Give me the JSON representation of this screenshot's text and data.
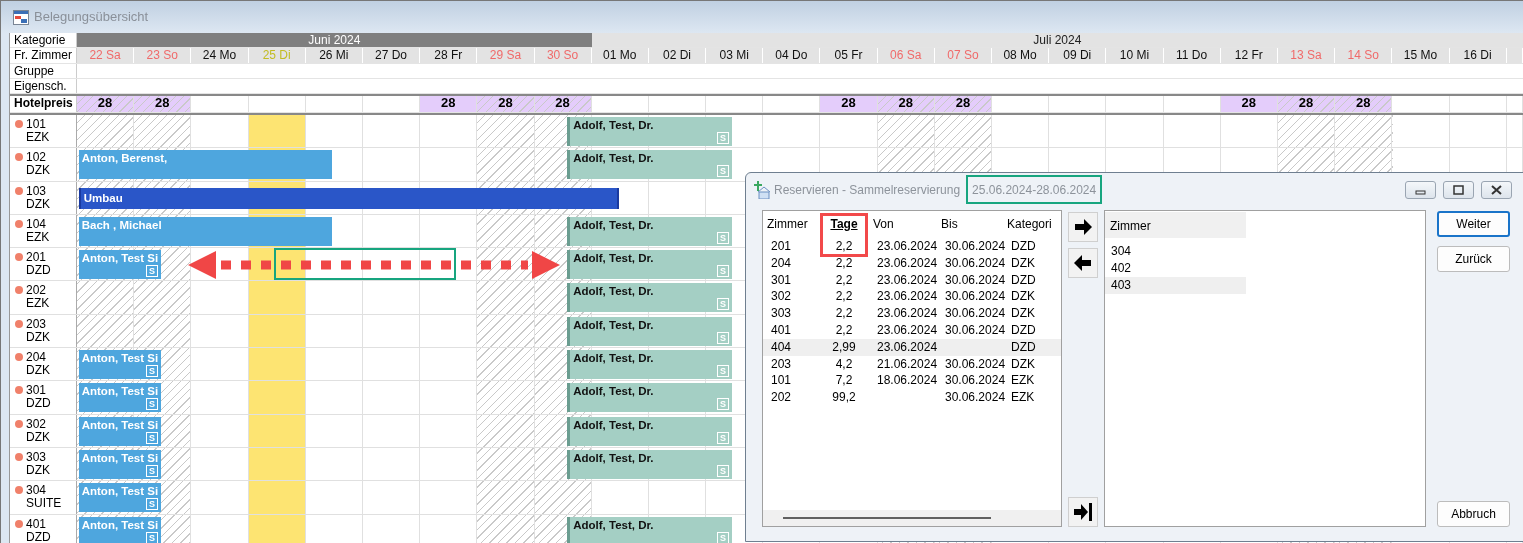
{
  "window": {
    "title": "Belegungsübersicht"
  },
  "header_labels": [
    "Kategorie",
    "Fr. Zimmer",
    "Gruppe",
    "Eigensch."
  ],
  "months": [
    {
      "label": "Juni 2024",
      "highlighted": true
    },
    {
      "label": "Juli 2024",
      "highlighted": false
    }
  ],
  "days": [
    {
      "label": "22 Sa",
      "weekend": true,
      "today": false,
      "price": "28"
    },
    {
      "label": "23 So",
      "weekend": true,
      "today": false,
      "price": "28"
    },
    {
      "label": "24 Mo",
      "weekend": false,
      "today": false
    },
    {
      "label": "25 Di",
      "weekend": false,
      "today": true
    },
    {
      "label": "26 Mi",
      "weekend": false,
      "today": false
    },
    {
      "label": "27 Do",
      "weekend": false,
      "today": false
    },
    {
      "label": "28 Fr",
      "weekend": false,
      "today": false,
      "price": "28"
    },
    {
      "label": "29 Sa",
      "weekend": true,
      "today": false,
      "price": "28"
    },
    {
      "label": "30 So",
      "weekend": true,
      "today": false,
      "price": "28"
    },
    {
      "label": "01 Mo",
      "weekend": false,
      "today": false
    },
    {
      "label": "02 Di",
      "weekend": false,
      "today": false
    },
    {
      "label": "03 Mi",
      "weekend": false,
      "today": false
    },
    {
      "label": "04 Do",
      "weekend": false,
      "today": false
    },
    {
      "label": "05 Fr",
      "weekend": false,
      "today": false,
      "price": "28"
    },
    {
      "label": "06 Sa",
      "weekend": true,
      "today": false,
      "price": "28"
    },
    {
      "label": "07 So",
      "weekend": true,
      "today": false,
      "price": "28"
    },
    {
      "label": "08 Mo",
      "weekend": false,
      "today": false
    },
    {
      "label": "09 Di",
      "weekend": false,
      "today": false
    },
    {
      "label": "10 Mi",
      "weekend": false,
      "today": false
    },
    {
      "label": "11 Do",
      "weekend": false,
      "today": false
    },
    {
      "label": "12 Fr",
      "weekend": false,
      "today": false,
      "price": "28"
    },
    {
      "label": "13 Sa",
      "weekend": true,
      "today": false,
      "price": "28"
    },
    {
      "label": "14 So",
      "weekend": true,
      "today": false,
      "price": "28"
    },
    {
      "label": "15 Mo",
      "weekend": false,
      "today": false
    },
    {
      "label": "16 Di",
      "weekend": false,
      "today": false
    }
  ],
  "price_label": "Hotelpreis",
  "rooms": [
    {
      "number": "101",
      "category": "EZK",
      "bookings": [
        {
          "kind": "option",
          "guest": "Adolf, Test, Dr.",
          "badge": "S"
        }
      ]
    },
    {
      "number": "102",
      "category": "DZK",
      "bookings": [
        {
          "kind": "guest",
          "guest": "Anton, Berenst,"
        },
        {
          "kind": "option",
          "guest": "Adolf, Test, Dr.",
          "badge": "S"
        }
      ]
    },
    {
      "number": "103",
      "category": "DZK",
      "bookings": [
        {
          "kind": "blocked",
          "guest": "Umbau"
        }
      ]
    },
    {
      "number": "104",
      "category": "EZK",
      "bookings": [
        {
          "kind": "guest",
          "guest": "Bach , Michael"
        },
        {
          "kind": "option",
          "guest": "Adolf, Test, Dr.",
          "badge": "S"
        }
      ]
    },
    {
      "number": "201",
      "category": "DZD",
      "bookings": [
        {
          "kind": "guest",
          "guest": "Anton, Test Si",
          "badge": "S"
        },
        {
          "kind": "option",
          "guest": "Adolf, Test, Dr.",
          "badge": "S"
        }
      ]
    },
    {
      "number": "202",
      "category": "EZK",
      "bookings": [
        {
          "kind": "option",
          "guest": "Adolf, Test, Dr.",
          "badge": "S"
        }
      ]
    },
    {
      "number": "203",
      "category": "DZK",
      "bookings": [
        {
          "kind": "option",
          "guest": "Adolf, Test, Dr.",
          "badge": "S"
        }
      ]
    },
    {
      "number": "204",
      "category": "DZK",
      "bookings": [
        {
          "kind": "guest",
          "guest": "Anton, Test Si",
          "badge": "S"
        },
        {
          "kind": "option",
          "guest": "Adolf, Test, Dr.",
          "badge": "S"
        }
      ]
    },
    {
      "number": "301",
      "category": "DZD",
      "bookings": [
        {
          "kind": "guest",
          "guest": "Anton, Test Si",
          "badge": "S"
        },
        {
          "kind": "option",
          "guest": "Adolf, Test, Dr.",
          "badge": "S"
        }
      ]
    },
    {
      "number": "302",
      "category": "DZK",
      "bookings": [
        {
          "kind": "guest",
          "guest": "Anton, Test Si",
          "badge": "S"
        },
        {
          "kind": "option",
          "guest": "Adolf, Test, Dr.",
          "badge": "S"
        }
      ]
    },
    {
      "number": "303",
      "category": "DZK",
      "bookings": [
        {
          "kind": "guest",
          "guest": "Anton, Test Si",
          "badge": "S"
        },
        {
          "kind": "option",
          "guest": "Adolf, Test, Dr.",
          "badge": "S"
        }
      ]
    },
    {
      "number": "304",
      "category": "SUITE",
      "bookings": [
        {
          "kind": "guest",
          "guest": "Anton, Test Si",
          "badge": "S"
        }
      ]
    },
    {
      "number": "401",
      "category": "DZD",
      "bookings": [
        {
          "kind": "guest",
          "guest": "Anton, Test Si",
          "badge": "S"
        },
        {
          "kind": "option",
          "guest": "Adolf, Test, Dr.",
          "badge": "S"
        }
      ]
    }
  ],
  "dialog": {
    "title": "Reservieren - Sammelreservierung",
    "date_range": "25.06.2024-28.06.2024",
    "available_rooms": {
      "columns": [
        {
          "label": "Zimmer",
          "sorted": false
        },
        {
          "label": "Tage",
          "sorted": true
        },
        {
          "label": "Von",
          "sorted": false
        },
        {
          "label": "Bis",
          "sorted": false
        },
        {
          "label": "Kategori",
          "sorted": false
        }
      ],
      "rows": [
        {
          "room": "201",
          "days": "2,2",
          "from": "23.06.2024",
          "to": "30.06.2024",
          "category": "DZD",
          "selected": false
        },
        {
          "room": "204",
          "days": "2,2",
          "from": "23.06.2024",
          "to": "30.06.2024",
          "category": "DZK",
          "selected": false
        },
        {
          "room": "301",
          "days": "2,2",
          "from": "23.06.2024",
          "to": "30.06.2024",
          "category": "DZD",
          "selected": false
        },
        {
          "room": "302",
          "days": "2,2",
          "from": "23.06.2024",
          "to": "30.06.2024",
          "category": "DZK",
          "selected": false
        },
        {
          "room": "303",
          "days": "2,2",
          "from": "23.06.2024",
          "to": "30.06.2024",
          "category": "DZK",
          "selected": false
        },
        {
          "room": "401",
          "days": "2,2",
          "from": "23.06.2024",
          "to": "30.06.2024",
          "category": "DZD",
          "selected": false
        },
        {
          "room": "404",
          "days": "2,99",
          "from": "23.06.2024",
          "category": "DZD",
          "selected": true
        },
        {
          "room": "203",
          "days": "4,2",
          "from": "21.06.2024",
          "to": "30.06.2024",
          "category": "DZK",
          "selected": false
        },
        {
          "room": "101",
          "days": "7,2",
          "from": "18.06.2024",
          "to": "30.06.2024",
          "category": "EZK",
          "selected": false
        },
        {
          "room": "202",
          "days": "99,2",
          "to": "30.06.2024",
          "category": "EZK",
          "selected": false
        }
      ]
    },
    "chosen_rooms": {
      "column": "Zimmer",
      "rows": [
        {
          "room": "304",
          "selected": false
        },
        {
          "room": "402",
          "selected": false
        },
        {
          "room": "403",
          "selected": true
        }
      ]
    },
    "buttons": [
      {
        "label": "Weiter",
        "default": true
      },
      {
        "label": "Zurück",
        "default": false
      },
      {
        "label": "Abbruch",
        "default": false
      }
    ]
  }
}
